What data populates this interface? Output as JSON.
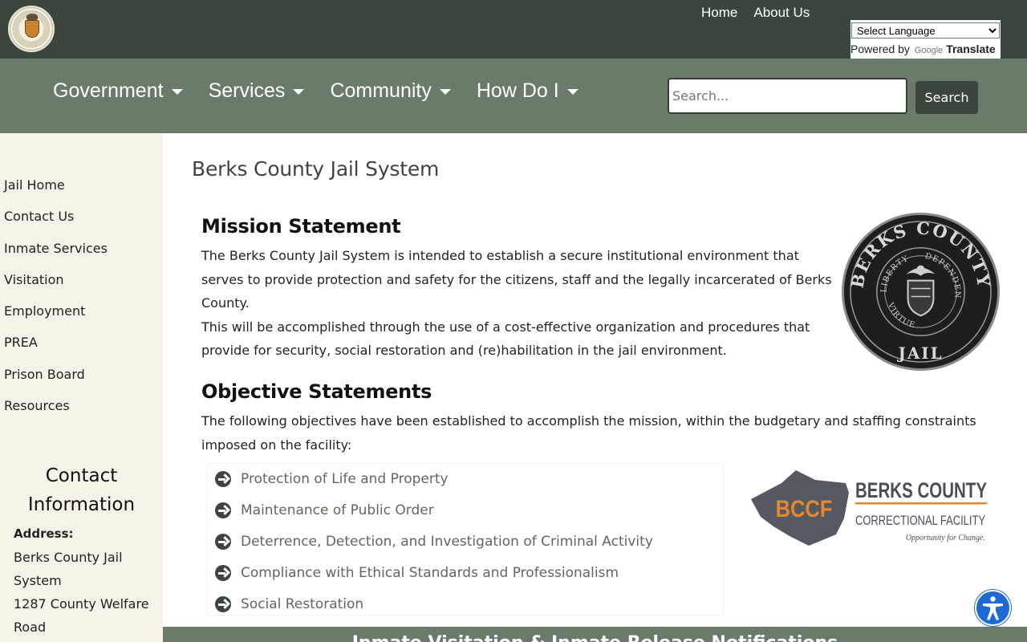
{
  "header": {
    "logo_alt": "County seal",
    "links": [
      "Home",
      "About Us"
    ],
    "translate": {
      "select_label": "Select Language",
      "powered_by": "Powered by",
      "google": "Google",
      "translate": "Translate"
    }
  },
  "nav": {
    "items": [
      "Government",
      "Services",
      "Community",
      "How Do I"
    ],
    "search_placeholder": "Search...",
    "search_button": "Search"
  },
  "sidebar": {
    "items": [
      "Jail Home",
      "Contact Us",
      "Inmate Services",
      "Visitation",
      "Employment",
      "PREA",
      "Prison Board",
      "Resources"
    ],
    "contact": {
      "title": "Contact Information",
      "address_label": "Address:",
      "address_lines": [
        "Berks County Jail System",
        "1287 County Welfare Road"
      ]
    }
  },
  "main": {
    "page_title": "Berks County Jail System",
    "mission_heading": "Mission Statement",
    "mission_p1": "The Berks County Jail System is intended to establish a secure institutional environment that serves to provide protection and safety for the citizens, staff and the legally incarcerated of Berks County.",
    "mission_p2": "This will be accomplished through the use of a cost-effective organization and procedures that provide for security, social restoration and (re)habilitation in the jail environment.",
    "seal_text": {
      "top": "BERKS COUNTY",
      "bottom": "JAIL",
      "inner_left": "LIBERTY",
      "inner_right": "INDEPENDENCE",
      "inner_bottom": "VIRTUE"
    },
    "objective_heading": "Objective Statements",
    "objective_intro": "The following objectives have been established to accomplish the mission, within the budgetary and staffing constraints imposed on the facility:",
    "objectives": [
      "Protection of Life and Property",
      "Maintenance of Public Order",
      "Deterrence, Detection, and Investigation of Criminal Activity",
      "Compliance with Ethical Standards and Professionalism",
      "Social Restoration"
    ],
    "bccf_logo": {
      "abbr": "BCCF",
      "line1": "BERKS COUNTY",
      "line2": "CORRECTIONAL FACILITY",
      "tagline": "Opportunity for Change."
    }
  },
  "bottom_banner": "Inmate Visitation & Inmate Release Notifications",
  "colors": {
    "topbar": "#3b473c",
    "navbar": "#6a7b6a",
    "sidebar": "#f5f2e7",
    "accent_orange": "#e8872a",
    "a11y_blue": "#1f69d4"
  }
}
